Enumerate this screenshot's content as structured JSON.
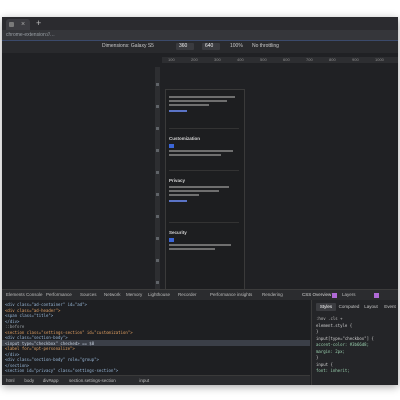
{
  "browser": {
    "tab_close": "×",
    "new_tab": "+",
    "url": "chrome-extension://…"
  },
  "device_toolbar": {
    "device": "Dimensions: Galaxy S5",
    "width": "360",
    "height": "640",
    "zoom": "100%",
    "throttle": "No throttling"
  },
  "ruler": {
    "ticks": [
      "100",
      "200",
      "300",
      "400",
      "500",
      "600",
      "700",
      "800",
      "900",
      "1000"
    ]
  },
  "page_sections": [
    {
      "title": ""
    },
    {
      "title": "Customization"
    },
    {
      "title": "Privacy"
    },
    {
      "title": "Security"
    }
  ],
  "panel_tabs": {
    "items": [
      "Elements",
      "Console",
      "Performance",
      "Sources",
      "Network",
      "Memory",
      "Lighthouse",
      "Recorder",
      "Performance insights",
      "Rendering",
      "CSS Overview",
      "Layers"
    ]
  },
  "code_lines": [
    {
      "text": "<div class=\"ad-container\" id=\"ad\">",
      "color": "#9bbbdc"
    },
    {
      "text": "  <div class=\"ad-header\">",
      "color": "#e5a263"
    },
    {
      "text": "    <span class=\"title\">",
      "color": "#9bbbdc"
    },
    {
      "text": "  </div>",
      "color": "#9bbbdc"
    },
    {
      "text": "  ::before",
      "color": "#9aa0a6"
    },
    {
      "text": "  <section class=\"settings-section\" id=\"customization\">",
      "color": "#e5a263"
    },
    {
      "text": "    <div class=\"section-body\">",
      "color": "#9bbbdc"
    },
    {
      "text": "      <input type=\"checkbox\" checked> == $0",
      "color": "#c8d2e0"
    },
    {
      "text": "      <label for=\"opt-personalize\">",
      "color": "#e5a263"
    },
    {
      "text": "    </div>",
      "color": "#9bbbdc"
    },
    {
      "text": "    <div class=\"section-body\" role=\"group\">",
      "color": "#9bbbdc"
    },
    {
      "text": "  </section>",
      "color": "#9bbbdc"
    },
    {
      "text": "  <section id=\"privacy\" class=\"settings-section\">",
      "color": "#9bbbdc"
    },
    {
      "text": "html  body  div#app  section.settings-section  input",
      "color": "#bdbdbd"
    }
  ],
  "styles_tabs": [
    "Styles",
    "Computed",
    "Layout",
    "Event Listeners"
  ],
  "style_lines": [
    {
      "text": ":hov .cls +",
      "color": "#bdbdbd"
    },
    {
      "text": "element.style {",
      "color": "#d0d0d0"
    },
    {
      "text": "}",
      "color": "#d0d0d0"
    },
    {
      "text": "input[type=\"checkbox\"] {",
      "color": "#d0d0d0"
    },
    {
      "text": "  accent-color: #3b66d8;",
      "color": "#9bd3b0"
    },
    {
      "text": "  margin: 2px;",
      "color": "#9bd3b0"
    },
    {
      "text": "}",
      "color": "#d0d0d0"
    },
    {
      "text": "input {",
      "color": "#d0d0d0"
    },
    {
      "text": "  font: inherit;",
      "color": "#9bd3b0"
    }
  ],
  "breadcrumbs": [
    "html",
    "body",
    "div#app",
    "section.settings-section",
    "input"
  ]
}
